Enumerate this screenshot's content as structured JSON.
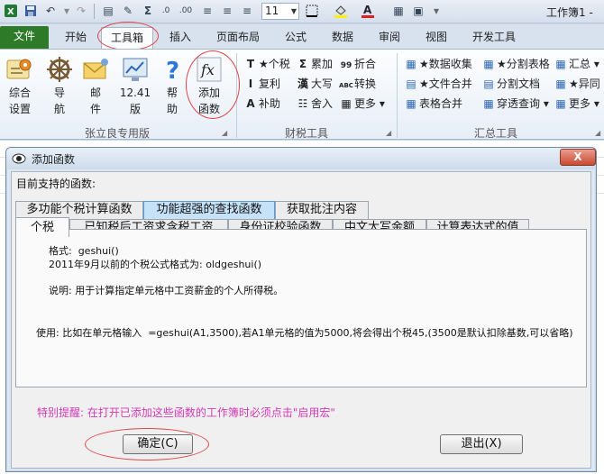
{
  "window": {
    "workbook_title": "工作簿1 -"
  },
  "qat": {
    "font_size": "11"
  },
  "ribbon_tabs": [
    {
      "label": "文件"
    },
    {
      "label": "开始"
    },
    {
      "label": "工具箱"
    },
    {
      "label": "插入"
    },
    {
      "label": "页面布局"
    },
    {
      "label": "公式"
    },
    {
      "label": "数据"
    },
    {
      "label": "审阅"
    },
    {
      "label": "视图"
    },
    {
      "label": "开发工具"
    }
  ],
  "ribbon": {
    "group1": {
      "label": "张立良专用版",
      "buttons": [
        {
          "l1": "综合",
          "l2": "设置"
        },
        {
          "l1": "导",
          "l2": "航"
        },
        {
          "l1": "邮",
          "l2": "件"
        },
        {
          "l1": "12.41",
          "l2": "版"
        },
        {
          "l1": "帮",
          "l2": "助"
        },
        {
          "l1": "添加",
          "l2": "函数"
        }
      ]
    },
    "group2": {
      "label": "财税工具",
      "items": [
        {
          "icon": "T",
          "label": "★个税"
        },
        {
          "icon": "Σ",
          "label": "累加"
        },
        {
          "icon": "99",
          "label": "折合"
        },
        {
          "icon": "I",
          "label": "复利"
        },
        {
          "icon": "漢",
          "label": "大写"
        },
        {
          "icon": "ABC",
          "label": "转换"
        },
        {
          "icon": "A",
          "label": "补助"
        },
        {
          "icon": "☷",
          "label": "舍入"
        },
        {
          "icon": "▦",
          "label": "更多 ▾"
        }
      ]
    },
    "group3": {
      "label": "汇总工具",
      "items": [
        {
          "label": "★数据收集"
        },
        {
          "label": "★分割表格"
        },
        {
          "label": "汇总 ▾"
        },
        {
          "label": "★文件合并"
        },
        {
          "label": "分割文档"
        },
        {
          "label": "★异同"
        },
        {
          "label": "表格合并"
        },
        {
          "label": "穿透查询 ▾"
        },
        {
          "label": "更多 ▾"
        }
      ]
    }
  },
  "dialog": {
    "title": "添加函数",
    "close_label": "X",
    "supported_label": "目前支持的函数:",
    "category_tabs": [
      {
        "label": "多功能个税计算函数"
      },
      {
        "label": "功能超强的查找函数"
      },
      {
        "label": "获取批注内容"
      }
    ],
    "function_tabs": [
      {
        "label": "个税"
      },
      {
        "label": "已知税后工资求含税工资"
      },
      {
        "label": "身份证校验函数"
      },
      {
        "label": "中文大写金额"
      },
      {
        "label": "计算表达式的值"
      }
    ],
    "detail": {
      "format_line": "格式:  geshui()",
      "old_format_line": "2011年9月以前的个税公式格式为: oldgeshui()",
      "description": "说明: 用于计算指定单元格中工资薪金的个人所得税。",
      "usage": "使用: 比如在单元格输入  =geshui(A1,3500),若A1单元格的值为5000,将会得出个税45,(3500是默认扣除基数,可以省略)"
    },
    "reminder": "特别提醒: 在打开已添加这些函数的工作簿时必须点击\"启用宏\"",
    "ok_label": "确定(C)",
    "exit_label": "退出(X)"
  },
  "colors": {
    "file_tab": "#2d7a28",
    "annotation_red": "#e04545",
    "reminder_magenta": "#d33ab6",
    "close_red": "#c84a32"
  }
}
